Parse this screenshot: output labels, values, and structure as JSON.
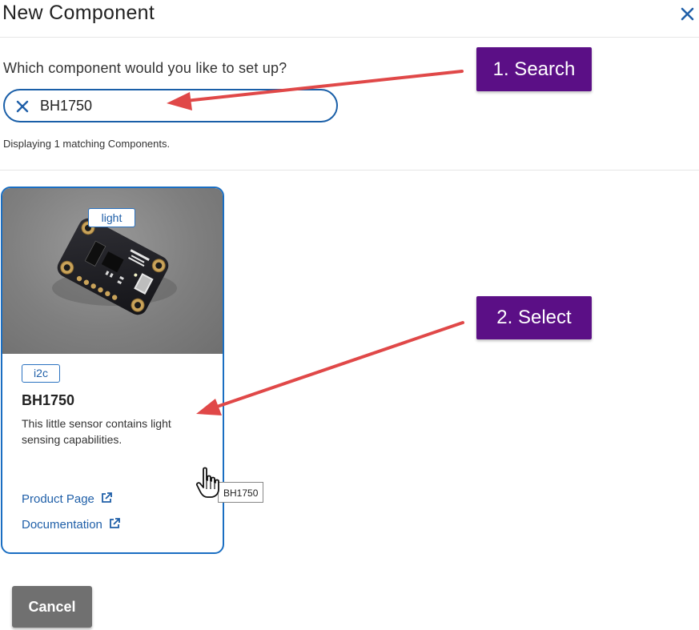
{
  "modal": {
    "title": "New Component",
    "close_icon": "close-icon"
  },
  "search": {
    "prompt": "Which component would you like to set up?",
    "value": "BH1750",
    "clear_icon": "clear-icon",
    "result_text": "Displaying 1 matching Components."
  },
  "results": [
    {
      "category_tag": "light",
      "bus_tag": "i2c",
      "name": "BH1750",
      "description": "This little sensor contains light sensing capabilities.",
      "product_link": "Product Page",
      "docs_link": "Documentation",
      "link_icon": "external-link-icon"
    }
  ],
  "annotations": {
    "step1": "1. Search",
    "step2": "2. Select",
    "arrow_color": "#e04848"
  },
  "tooltip": "BH1750",
  "footer": {
    "cancel_label": "Cancel"
  },
  "colors": {
    "accent": "#1a6ec2",
    "link": "#1f5fa8",
    "callout": "#5b0f86",
    "cancel": "#707070"
  }
}
